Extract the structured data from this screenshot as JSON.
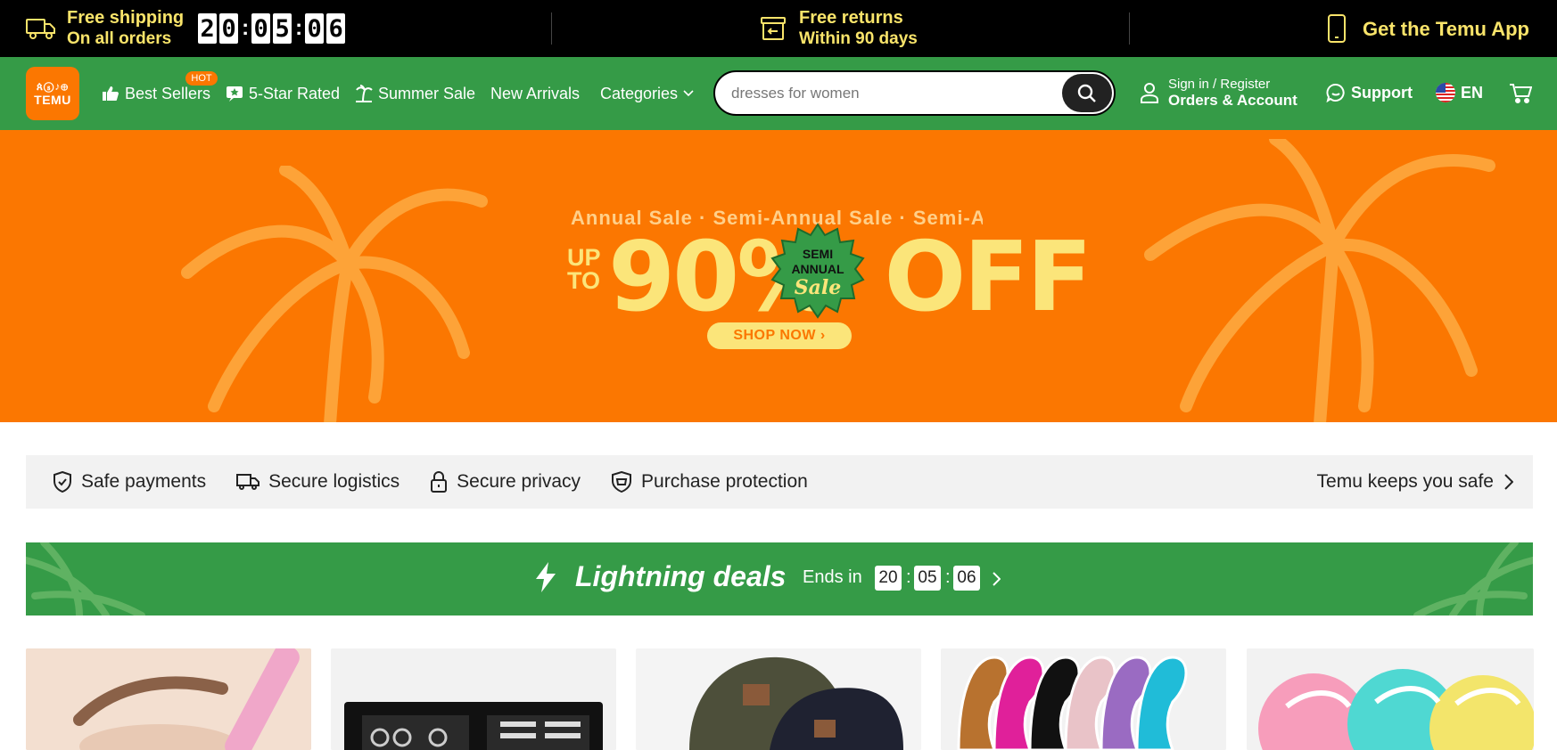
{
  "promo": {
    "shipping": {
      "title": "Free shipping",
      "sub": "On all orders",
      "icon": "truck-icon"
    },
    "countdown": {
      "h1": "2",
      "h2": "0",
      "m1": "0",
      "m2": "5",
      "s1": "0",
      "s2": "6"
    },
    "returns": {
      "title": "Free returns",
      "sub": "Within 90 days",
      "icon": "return-box-icon"
    },
    "app": {
      "label": "Get the Temu App",
      "icon": "phone-icon"
    }
  },
  "nav": {
    "logo": {
      "mark": "ጰⓢ♪⊕",
      "word": "TEMU"
    },
    "links": [
      {
        "label": "Best Sellers",
        "badge": "HOT"
      },
      {
        "label": "5-Star Rated"
      },
      {
        "label": "Summer Sale"
      },
      {
        "label": "New Arrivals"
      },
      {
        "label": "Categories"
      }
    ],
    "search": {
      "placeholder": "dresses for women"
    },
    "account": {
      "line1": "Sign in / Register",
      "line2": "Orders & Account"
    },
    "support": "Support",
    "language": "EN"
  },
  "hero": {
    "scroll_text": "Annual Sale · Semi-Annual Sale · Semi-Annual Sale",
    "up": "UP",
    "to": "TO",
    "percent": "90%",
    "off": "OFF",
    "badge": {
      "line1": "SEMI",
      "line2": "ANNUAL",
      "line3": "Sale"
    },
    "cta": "SHOP NOW ›",
    "colors": {
      "bg": "#fb7701",
      "text": "#fbe57a",
      "badge": "#359b47"
    }
  },
  "trust": {
    "items": [
      {
        "label": "Safe payments",
        "icon": "shield-check-icon"
      },
      {
        "label": "Secure logistics",
        "icon": "truck-icon"
      },
      {
        "label": "Secure privacy",
        "icon": "lock-icon"
      },
      {
        "label": "Purchase protection",
        "icon": "shield-badge-icon"
      }
    ],
    "keep": "Temu keeps you safe"
  },
  "deals": {
    "title": "Lightning deals",
    "ends_label": "Ends in",
    "hh": "20",
    "mm": "05",
    "ss": "06",
    "sep": ":"
  },
  "products": [
    {
      "name": "eyebrow-razor"
    },
    {
      "name": "manicure-kit"
    },
    {
      "name": "baseball-caps"
    },
    {
      "name": "crystal-hair-removers"
    },
    {
      "name": "silicone-bath-brushes"
    }
  ],
  "colors": {
    "green": "#359b47",
    "orange": "#fb7701",
    "yellow": "#f9e46a"
  }
}
